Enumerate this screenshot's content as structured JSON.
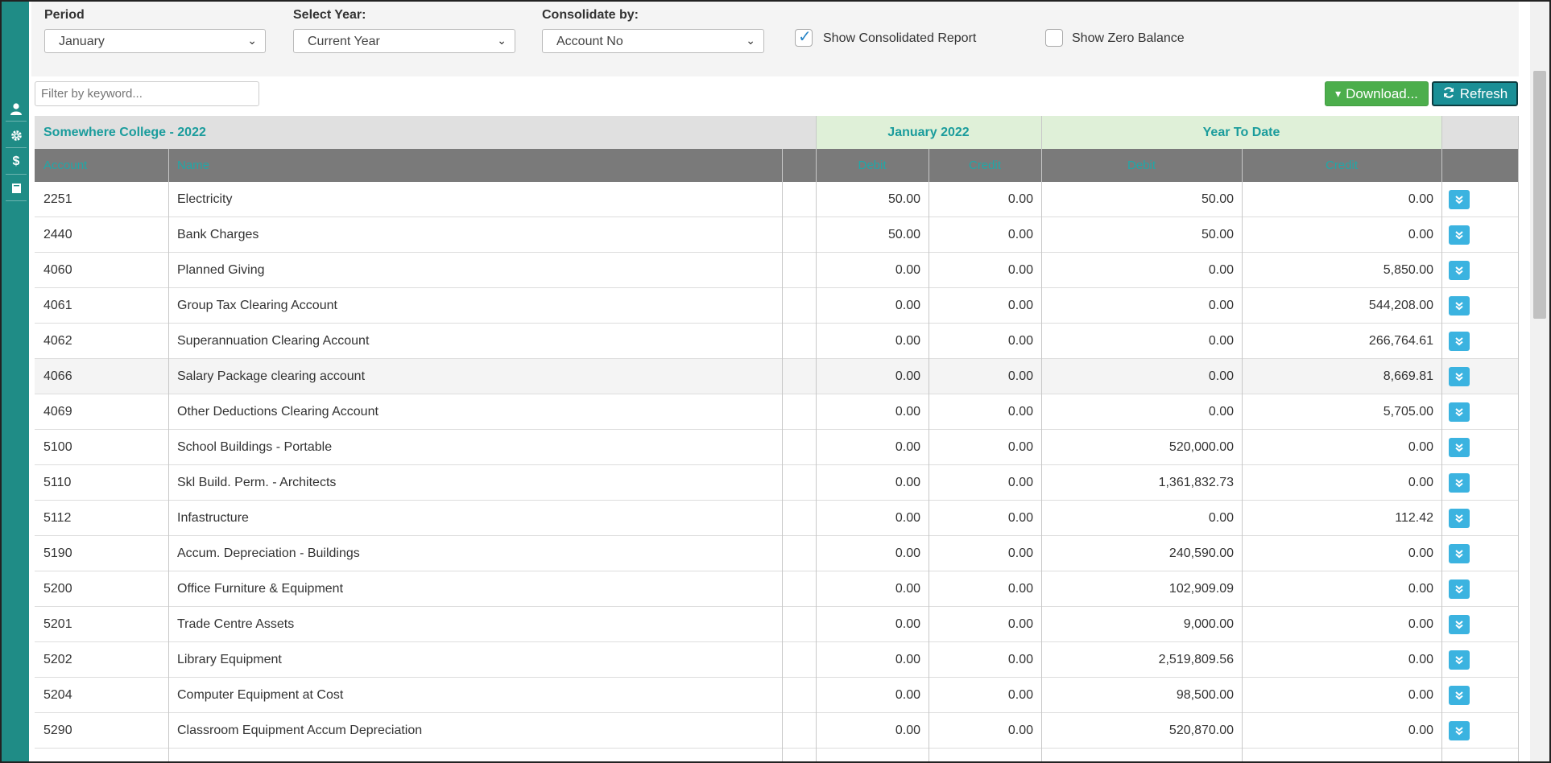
{
  "filters": {
    "period": {
      "label": "Period",
      "value": "January"
    },
    "year": {
      "label": "Select Year:",
      "value": "Current Year"
    },
    "consolidate": {
      "label": "Consolidate by:",
      "value": "Account No"
    },
    "show_consolidated": {
      "label": "Show Consolidated Report",
      "checked": true
    },
    "show_zero": {
      "label": "Show Zero Balance",
      "checked": false
    }
  },
  "search": {
    "placeholder": "Filter by keyword..."
  },
  "toolbar": {
    "download_label": "Download...",
    "refresh_label": "Refresh"
  },
  "report": {
    "title": "Somewhere College - 2022",
    "period_header": "January 2022",
    "ytd_header": "Year To Date",
    "columns": {
      "account": "Account",
      "name": "Name",
      "debit": "Debit",
      "credit": "Credit"
    }
  },
  "rows": [
    {
      "account": "2251",
      "name": "Electricity",
      "debit": "50.00",
      "credit": "0.00",
      "ytd_debit": "50.00",
      "ytd_credit": "0.00"
    },
    {
      "account": "2440",
      "name": "Bank Charges",
      "debit": "50.00",
      "credit": "0.00",
      "ytd_debit": "50.00",
      "ytd_credit": "0.00"
    },
    {
      "account": "4060",
      "name": "Planned Giving",
      "debit": "0.00",
      "credit": "0.00",
      "ytd_debit": "0.00",
      "ytd_credit": "5,850.00"
    },
    {
      "account": "4061",
      "name": "Group Tax Clearing Account",
      "debit": "0.00",
      "credit": "0.00",
      "ytd_debit": "0.00",
      "ytd_credit": "544,208.00"
    },
    {
      "account": "4062",
      "name": "Superannuation Clearing Account",
      "debit": "0.00",
      "credit": "0.00",
      "ytd_debit": "0.00",
      "ytd_credit": "266,764.61"
    },
    {
      "account": "4066",
      "name": "Salary Package clearing account",
      "debit": "0.00",
      "credit": "0.00",
      "ytd_debit": "0.00",
      "ytd_credit": "8,669.81"
    },
    {
      "account": "4069",
      "name": "Other Deductions Clearing Account",
      "debit": "0.00",
      "credit": "0.00",
      "ytd_debit": "0.00",
      "ytd_credit": "5,705.00"
    },
    {
      "account": "5100",
      "name": "School Buildings - Portable",
      "debit": "0.00",
      "credit": "0.00",
      "ytd_debit": "520,000.00",
      "ytd_credit": "0.00"
    },
    {
      "account": "5110",
      "name": "Skl Build. Perm. - Architects",
      "debit": "0.00",
      "credit": "0.00",
      "ytd_debit": "1,361,832.73",
      "ytd_credit": "0.00"
    },
    {
      "account": "5112",
      "name": "Infastructure",
      "debit": "0.00",
      "credit": "0.00",
      "ytd_debit": "0.00",
      "ytd_credit": "112.42"
    },
    {
      "account": "5190",
      "name": "Accum. Depreciation - Buildings",
      "debit": "0.00",
      "credit": "0.00",
      "ytd_debit": "240,590.00",
      "ytd_credit": "0.00"
    },
    {
      "account": "5200",
      "name": "Office Furniture & Equipment",
      "debit": "0.00",
      "credit": "0.00",
      "ytd_debit": "102,909.09",
      "ytd_credit": "0.00"
    },
    {
      "account": "5201",
      "name": "Trade Centre Assets",
      "debit": "0.00",
      "credit": "0.00",
      "ytd_debit": "9,000.00",
      "ytd_credit": "0.00"
    },
    {
      "account": "5202",
      "name": "Library Equipment",
      "debit": "0.00",
      "credit": "0.00",
      "ytd_debit": "2,519,809.56",
      "ytd_credit": "0.00"
    },
    {
      "account": "5204",
      "name": "Computer Equipment at Cost",
      "debit": "0.00",
      "credit": "0.00",
      "ytd_debit": "98,500.00",
      "ytd_credit": "0.00"
    },
    {
      "account": "5290",
      "name": "Classroom Equipment Accum Depreciation",
      "debit": "0.00",
      "credit": "0.00",
      "ytd_debit": "520,870.00",
      "ytd_credit": "0.00"
    }
  ],
  "colors": {
    "teal": "#1f8c86",
    "header_text": "#1a9c9c",
    "period_bg": "#dff0d8",
    "download": "#4cae4c",
    "refresh": "#1a8f96",
    "expand": "#3bb3e0"
  },
  "icons": {
    "sidebar": [
      "user-icon",
      "gear-icon",
      "dollar-icon",
      "book-icon"
    ],
    "row_action": "double-chevron-down-icon"
  }
}
